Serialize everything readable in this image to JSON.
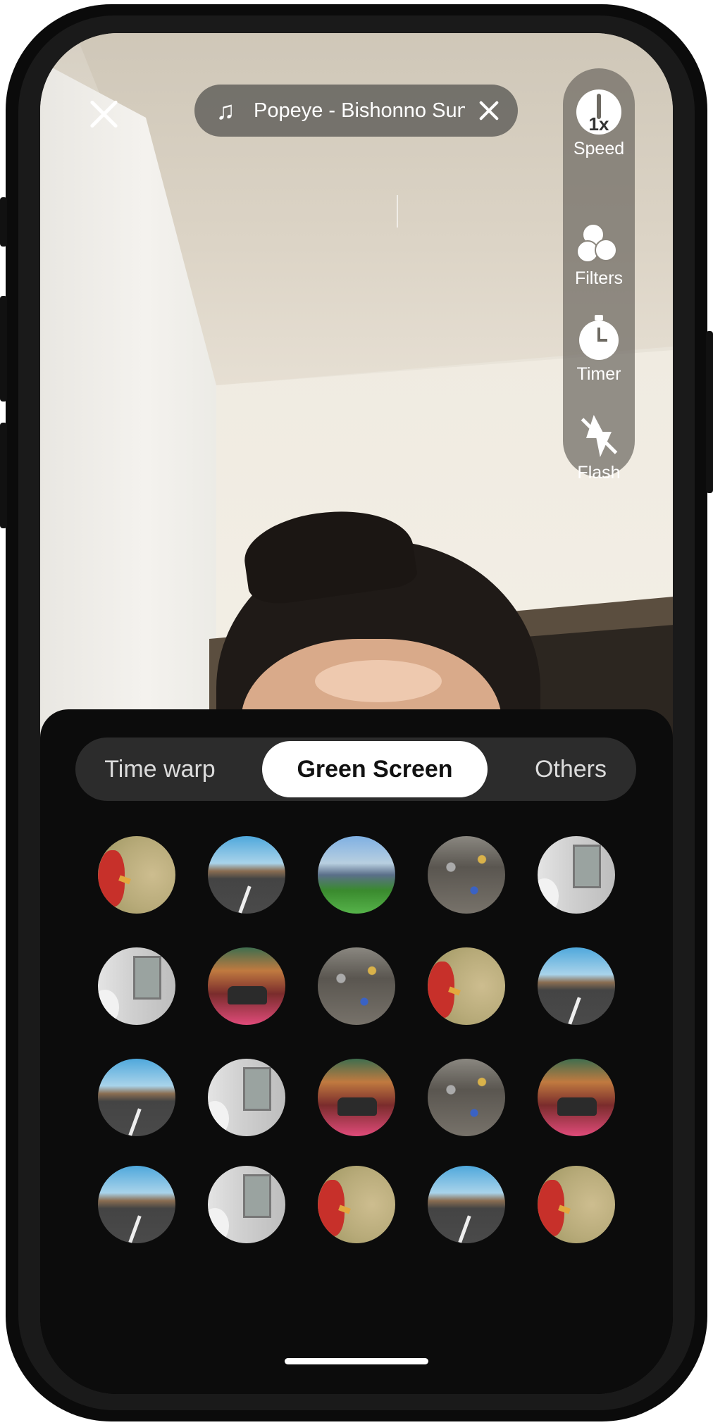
{
  "music": {
    "title": "Popeye - Bishonno Sun...",
    "icon": "music-note-icon"
  },
  "tools": [
    {
      "label": "Speed",
      "value": "1x",
      "icon": "speed-icon"
    },
    {
      "label": "Filters",
      "icon": "filters-icon"
    },
    {
      "label": "Timer",
      "icon": "timer-icon"
    },
    {
      "label": "Flash",
      "icon": "flash-off-icon"
    }
  ],
  "tabs": [
    {
      "label": "Time warp",
      "active": false
    },
    {
      "label": "Green Screen",
      "active": true
    },
    {
      "label": "Others",
      "active": false
    }
  ],
  "backgrounds": [
    [
      "rooster",
      "road",
      "stadium",
      "garbage",
      "bathroom"
    ],
    [
      "bathroom",
      "street",
      "garbage",
      "rooster",
      "road"
    ],
    [
      "road",
      "bathroom",
      "street",
      "garbage",
      "street"
    ],
    [
      "road",
      "bathroom",
      "rooster",
      "road",
      "rooster"
    ]
  ]
}
